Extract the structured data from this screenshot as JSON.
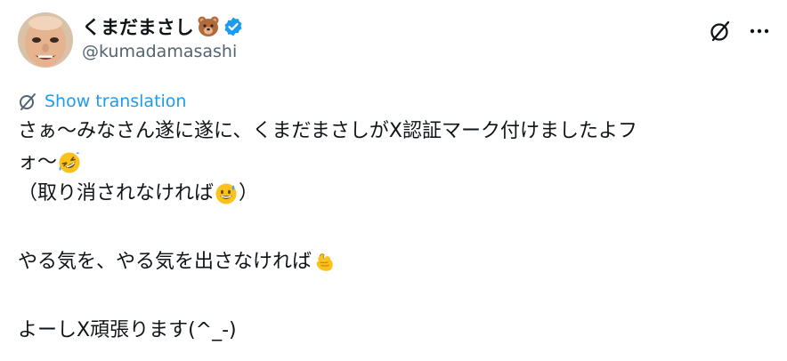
{
  "author": {
    "display_name": "くまだまさし",
    "handle": "@kumadamasashi",
    "name_emoji": "bear-face-emoji",
    "verified": true
  },
  "actions": {
    "grok_icon": "grok-icon",
    "more_icon": "more-icon"
  },
  "translation": {
    "label": "Show translation"
  },
  "post": {
    "line1": "さぁ〜みなさん遂に遂に、くまだまさしがX認証マーク付けましたよフ",
    "line2_text": "ォ〜",
    "line2_emoji": "rolling-on-floor-laughing-emoji",
    "line3_text": "（取り消されなければ",
    "line3_emoji": "grinning-sweat-emoji",
    "line3_end": "）",
    "line4_text": "やる気を、やる気を出さなければ",
    "line4_emoji": "thumbs-pointing-hand-emoji",
    "line5_text": "よーしX頑張ります(^_-)"
  },
  "colors": {
    "text": "#0f1419",
    "secondary": "#536471",
    "link": "#1d9bf0",
    "verified": "#1d9bf0"
  }
}
